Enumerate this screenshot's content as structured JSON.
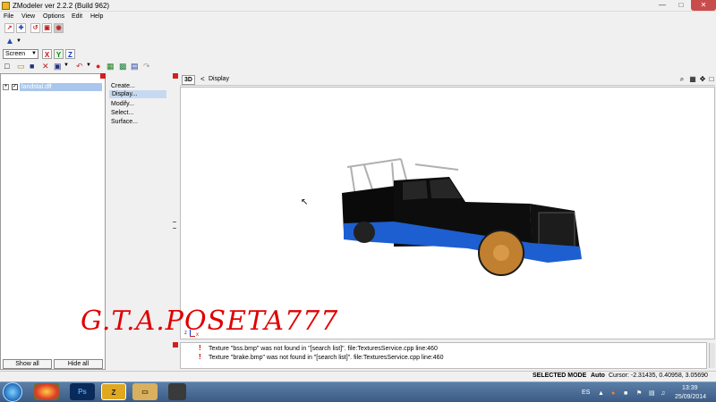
{
  "window": {
    "title": "ZModeler ver 2.2.2 (Build 962)",
    "minimize_icon": "minimize-icon",
    "maximize_icon": "maximize-icon",
    "close_icon": "close-icon"
  },
  "menu": [
    "File",
    "View",
    "Options",
    "Edit",
    "Help"
  ],
  "toolbar": {
    "view_mode": "Screen",
    "axes": [
      "X",
      "Y",
      "Z"
    ],
    "axis_colors": {
      "X": "#d01010",
      "Y": "#108010",
      "Z": "#1030c0"
    }
  },
  "tree": {
    "item_label": "landstal.dff",
    "show_all": "Show all",
    "hide_all": "Hide all"
  },
  "commands": [
    "Create...",
    "Display...",
    "Modify...",
    "Select...",
    "Surface..."
  ],
  "viewport": {
    "mode_label": "3D",
    "nav_glyph": "<",
    "title": "Display"
  },
  "watermark": "G.T.A.POSETA777",
  "gizmo": {
    "z": "z",
    "x": "x"
  },
  "log": [
    "Texture \"bss.bmp\" was not found in \"[search list]\". file:TexturesService.cpp line:460",
    "Texture \"brake.bmp\" was not found in \"[search list]\". file:TexturesService.cpp line:460"
  ],
  "status": {
    "mode": "SELECTED MODE",
    "auto": "Auto",
    "cursor": "Cursor: -2.31435, 0.40958, 3.05690"
  },
  "taskbar": {
    "lang": "ES",
    "time": "13:39",
    "date": "25/09/2014"
  }
}
